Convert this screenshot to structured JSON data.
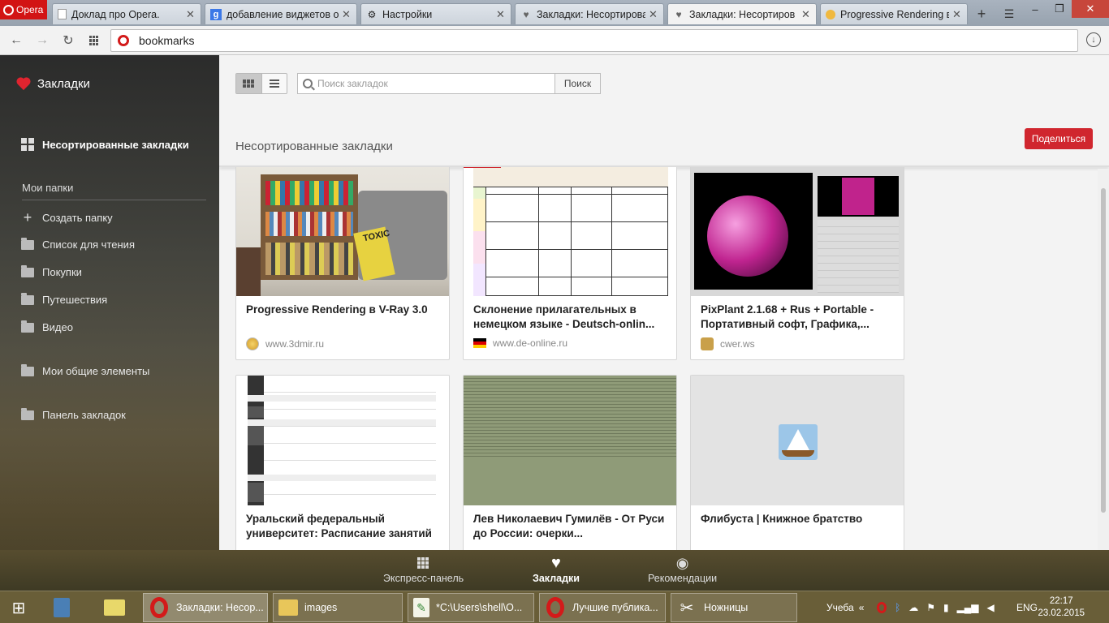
{
  "browser": {
    "menu_label": "Opera",
    "tabs": [
      {
        "title": "Доклад про Opera.",
        "icon": "document-icon",
        "active": false
      },
      {
        "title": "добавление виджетов о",
        "icon": "google-icon",
        "active": false
      },
      {
        "title": "Настройки",
        "icon": "gear-icon",
        "active": false
      },
      {
        "title": "Закладки: Несортирова",
        "icon": "heart-icon",
        "active": false
      },
      {
        "title": "Закладки: Несортиров",
        "icon": "heart-icon",
        "active": true
      },
      {
        "title": "Progressive Rendering в",
        "icon": "globe-icon",
        "active": false
      }
    ],
    "address": "bookmarks"
  },
  "sidebar": {
    "title": "Закладки",
    "unsorted": "Несортированные закладки",
    "my_folders": "Мои папки",
    "create_folder": "Создать папку",
    "folders": [
      "Список для чтения",
      "Покупки",
      "Путешествия",
      "Видео"
    ],
    "shared": "Мои общие элементы",
    "bar": "Панель закладок"
  },
  "main": {
    "search_placeholder": "Поиск закладок",
    "search_button": "Поиск",
    "section_title": "Несортированные закладки",
    "share_button": "Поделиться",
    "cards": [
      {
        "title": "Progressive Rendering в V-Ray 3.0",
        "url": "www.3dmir.ru"
      },
      {
        "title": "Склонение прилагательных в немецком языке - Deutsch-onlin...",
        "url": "www.de-online.ru"
      },
      {
        "title": "PixPlant 2.1.68 + Rus + Portable - Портативный софт, Графика,...",
        "url": "cwer.ws"
      },
      {
        "title": "Уральский федеральный университет: Расписание занятий",
        "url": ""
      },
      {
        "title": "Лев Николаевич Гумилёв - От Руси до России: очерки...",
        "url": ""
      },
      {
        "title": "Флибуста | Книжное братство",
        "url": ""
      }
    ]
  },
  "bottom": {
    "speed_dial": "Экспресс-панель",
    "bookmarks": "Закладки",
    "recommendations": "Рекомендации"
  },
  "taskbar": {
    "items": [
      {
        "label": "Закладки: Несор...",
        "icon": "opera-icon"
      },
      {
        "label": "images",
        "icon": "folder-icon"
      },
      {
        "label": "*C:\\Users\\shell\\O...",
        "icon": "notepad-icon"
      },
      {
        "label": "Лучшие публика...",
        "icon": "opera-icon"
      },
      {
        "label": "Ножницы",
        "icon": "scissors-icon"
      }
    ],
    "tray_label": "Учеба",
    "lang": "ENG",
    "time": "22:17",
    "date": "23.02.2015"
  }
}
